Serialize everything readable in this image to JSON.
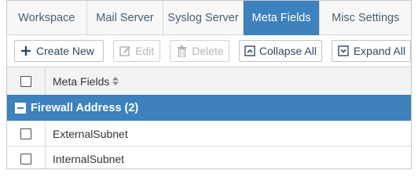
{
  "tabs": [
    {
      "label": "Workspace",
      "active": false
    },
    {
      "label": "Mail Server",
      "active": false
    },
    {
      "label": "Syslog Server",
      "active": false
    },
    {
      "label": "Meta Fields",
      "active": true
    },
    {
      "label": "Misc Settings",
      "active": false
    }
  ],
  "toolbar": {
    "create_new": {
      "label": "Create New",
      "icon": "plus-icon",
      "enabled": true
    },
    "edit": {
      "label": "Edit",
      "icon": "edit-icon",
      "enabled": false
    },
    "delete": {
      "label": "Delete",
      "icon": "trash-icon",
      "enabled": false
    },
    "collapse_all": {
      "label": "Collapse All",
      "icon": "collapse-icon",
      "enabled": true
    },
    "expand_all": {
      "label": "Expand All",
      "icon": "expand-icon",
      "enabled": true
    }
  },
  "table": {
    "header": {
      "label": "Meta Fields",
      "sort_icon": "sort-icon"
    },
    "groups": [
      {
        "label": "Firewall Address (2)",
        "expanded": true,
        "rows": [
          {
            "label": "ExternalSubnet"
          },
          {
            "label": "InternalSubnet"
          }
        ]
      }
    ]
  },
  "colors": {
    "accent": "#3d81bd",
    "tab_text": "#4a5f73",
    "button_text": "#2f4a63"
  }
}
